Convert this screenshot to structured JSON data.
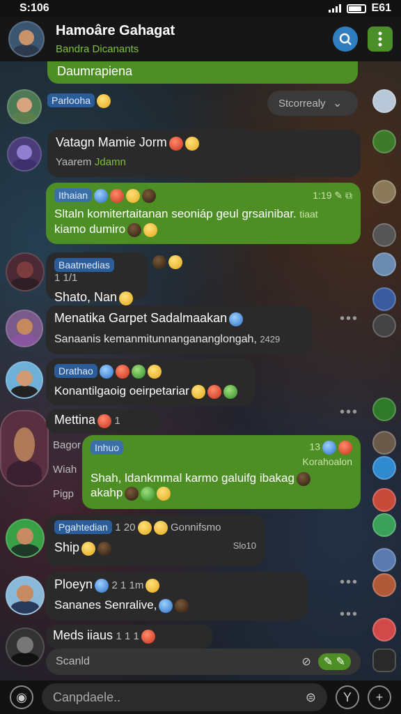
{
  "status": {
    "time": "S:106",
    "battery": "E61"
  },
  "header": {
    "title": "Hamoâre Gahagat",
    "subtitle": "Bandra Dicanants"
  },
  "colors": {
    "accent_green": "#4e8f25",
    "tag_blue": "#2b5d9a",
    "bubble_dark": "#2a2a2a"
  },
  "chat": {
    "top_outgoing": "Daumrapiena",
    "unread_pill": "Stcorrealy",
    "messages": [
      {
        "name": "Parlooha",
        "text": ""
      },
      {
        "name": "Vatagn Mamie Jorm",
        "text": "Yaarem",
        "sub_extra": "Jdamn"
      },
      {
        "name": "Ithaian",
        "time": "1:19",
        "text": "Sltaln komitertaitanan seoniáp geul grsainibar.",
        "side": "tiaat",
        "text2": "kiamo dumiro"
      },
      {
        "name": "Baatmedias",
        "count": "1 1/1",
        "text": "Shato, Nan"
      },
      {
        "name": "Menatika Garpet Sadalmaakan",
        "text": "Sanaanis kemanmitunnangananglongah,",
        "sub_extra": "2429"
      },
      {
        "name": "Drathao",
        "text": "Konantilgaoig oeirpetariar"
      },
      {
        "name": "Mettina",
        "count": "1"
      },
      {
        "name": "Inhuo",
        "time": "13",
        "side": "Korahoalon",
        "text": "Shah, ldankmmal karmo galuifg ibakag",
        "text2": "akahp"
      },
      {
        "left_labels": [
          "Bagor",
          "Wiah",
          "Pigp"
        ]
      },
      {
        "name": "Pgahtedian",
        "count": "1 20",
        "extra": "Gonnifsmo",
        "text": "Ship",
        "sub_extra": "Slo10"
      },
      {
        "name": "Ploeyn",
        "count": "2 1 1m",
        "text": "Sananes Senralive,"
      },
      {
        "name": "Meds iiaus",
        "count": "1 1 1"
      }
    ],
    "search_chip": "Scanld"
  },
  "composer": {
    "placeholder": "Canpdaele.."
  }
}
